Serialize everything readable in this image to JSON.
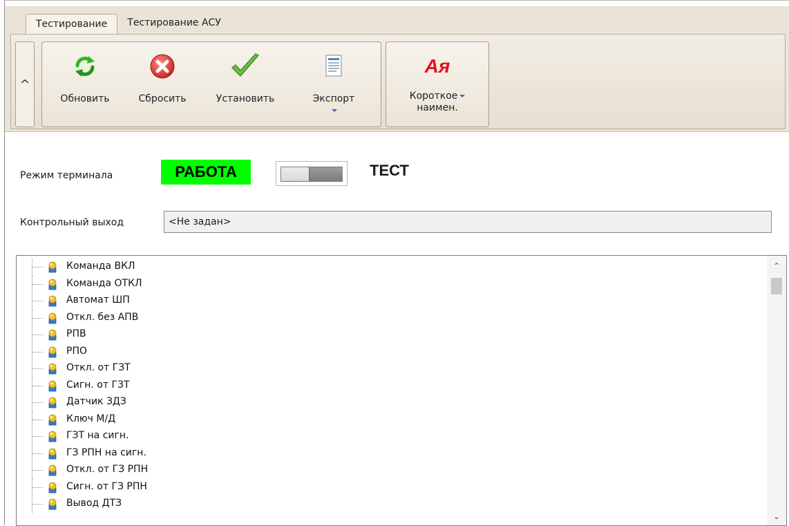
{
  "tabs": [
    {
      "label": "Тестирование",
      "active": true
    },
    {
      "label": "Тестирование АСУ",
      "active": false
    }
  ],
  "ribbon": {
    "collapse_glyph": "^",
    "buttons": {
      "refresh": {
        "label": "Обновить",
        "icon": "refresh-icon"
      },
      "reset": {
        "label": "Сбросить",
        "icon": "reset-icon"
      },
      "apply": {
        "label": "Установить",
        "icon": "checkmark-icon"
      },
      "export": {
        "label": "Экспорт",
        "icon": "document-icon"
      },
      "shortname": {
        "icon_text": "Ая",
        "label_line1": "Короткое",
        "label_line2": "наимен.",
        "icon": "short-name-icon"
      }
    }
  },
  "mode": {
    "label": "Режим терминала",
    "work_text": "РАБОТА",
    "test_text": "ТЕСТ",
    "work_color": "#00ff00"
  },
  "control_output": {
    "label": "Контрольный выход",
    "value": "<Не задан>"
  },
  "tree": {
    "node_icon": "signal-node-icon",
    "items": [
      "Команда ВКЛ",
      "Команда ОТКЛ",
      "Автомат ШП",
      "Откл. без АПВ",
      "РПВ",
      "РПО",
      "Откл. от ГЗТ",
      "Сигн. от ГЗТ",
      "Датчик ЗДЗ",
      "Ключ М/Д",
      "ГЗТ на сигн.",
      "ГЗ РПН на сигн.",
      "Откл. от ГЗ РПН",
      "Сигн. от ГЗ РПН",
      "Вывод ДТЗ"
    ]
  }
}
